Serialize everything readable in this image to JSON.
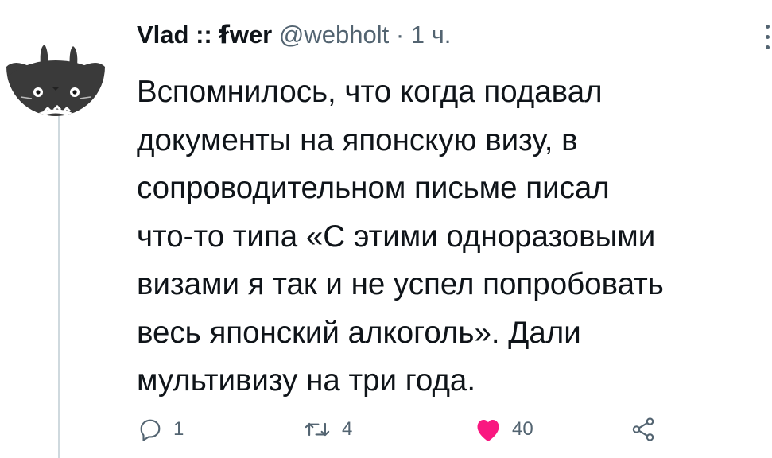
{
  "tweet": {
    "display_name": "Vlad :: ẜwer",
    "handle": "@webholt",
    "separator": "·",
    "time": "1 ч.",
    "text_lines": [
      "Вспомнилось, что когда подавал",
      "документы на японскую визу, в",
      "сопроводительном письме писал",
      "что-то типа «С этими одноразовыми",
      "визами я так и не успел попробовать",
      "весь японский алкоголь». Дали",
      "мультивизу на три года."
    ]
  },
  "actions": {
    "reply": {
      "icon": "reply-icon",
      "count": "1"
    },
    "retweet": {
      "icon": "retweet-icon",
      "count": "4"
    },
    "like": {
      "icon": "heart-icon",
      "count": "40",
      "color": "#f91880"
    },
    "share": {
      "icon": "share-icon"
    }
  },
  "colors": {
    "text": "#0f1419",
    "secondary": "#536471",
    "thread_line": "#cfd9de",
    "like": "#f91880"
  }
}
